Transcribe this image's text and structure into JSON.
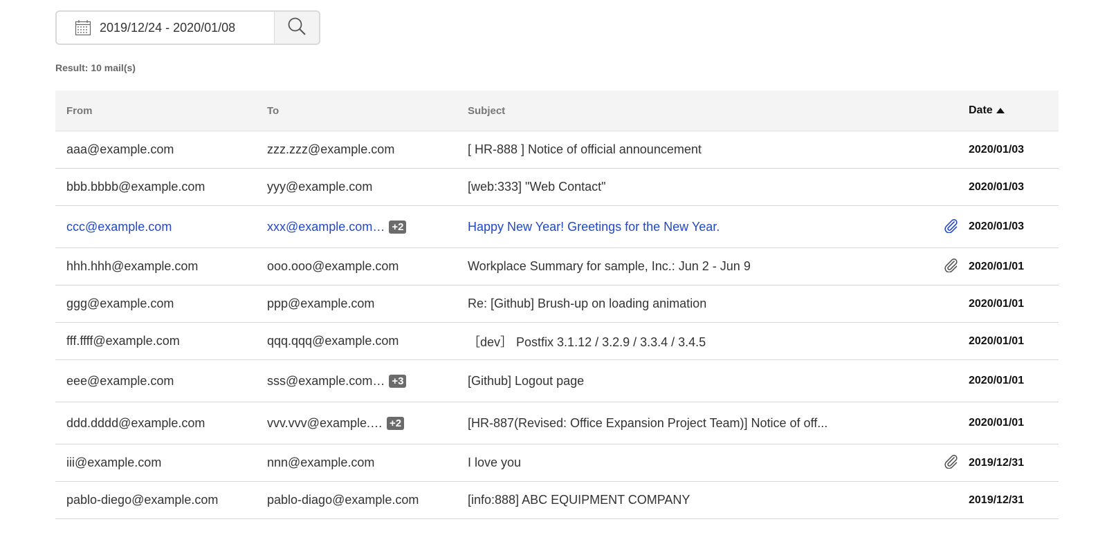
{
  "search": {
    "date_range": "2019/12/24 - 2020/01/08",
    "date_icon": "calendar-icon",
    "search_icon": "magnifier-icon"
  },
  "result_label": "Result: 10 mail(s)",
  "columns": {
    "from": "From",
    "to": "To",
    "subject": "Subject",
    "date": "Date"
  },
  "colors": {
    "unread": "#2148c9",
    "badge": "#6b6b6b",
    "header_bg": "#f4f4f4"
  },
  "rows": [
    {
      "from": "aaa@example.com",
      "to": "zzz.zzz@example.com",
      "badge": "",
      "subject": "[ HR-888 ] Notice of official announcement",
      "attachment": false,
      "date": "2020/01/03"
    },
    {
      "from": "bbb.bbbb@example.com",
      "to": "yyy@example.com",
      "badge": "",
      "subject": "[web:333] \"Web Contact\"",
      "attachment": false,
      "date": "2020/01/03"
    },
    {
      "from": "ccc@example.com",
      "to": "xxx@example.com…",
      "badge": "+2",
      "subject": "Happy New Year! Greetings for the New Year.",
      "attachment": true,
      "date": "2020/01/03",
      "unread": true
    },
    {
      "from": "hhh.hhh@example.com",
      "to": "ooo.ooo@example.com",
      "badge": "",
      "subject": "Workplace Summary for sample, Inc.: Jun 2 - Jun 9",
      "attachment": true,
      "date": "2020/01/01"
    },
    {
      "from": "ggg@example.com",
      "to": "ppp@example.com",
      "badge": "",
      "subject": "Re: [Github] Brush-up on loading animation",
      "attachment": false,
      "date": "2020/01/01"
    },
    {
      "from": "fff.ffff@example.com",
      "to": "qqq.qqq@example.com",
      "badge": "",
      "subject": "［dev］ Postfix 3.1.12 / 3.2.9 / 3.3.4 / 3.4.5",
      "attachment": false,
      "date": "2020/01/01"
    },
    {
      "from": "eee@example.com",
      "to": "sss@example.com…",
      "badge": "+3",
      "subject": "[Github] Logout page",
      "attachment": false,
      "date": "2020/01/01"
    },
    {
      "from": "ddd.dddd@example.com",
      "to": "vvv.vvv@example.…",
      "badge": "+2",
      "subject": "[HR-887(Revised: Office Expansion Project Team)] Notice of off...",
      "attachment": false,
      "date": "2020/01/01"
    },
    {
      "from": "iii@example.com",
      "to": "nnn@example.com",
      "badge": "",
      "subject": "I love you",
      "attachment": true,
      "date": "2019/12/31"
    },
    {
      "from": "pablo-diego@example.com",
      "to": "pablo-diago@example.com",
      "badge": "",
      "subject": "[info:888] ABC EQUIPMENT COMPANY",
      "attachment": false,
      "date": "2019/12/31"
    }
  ]
}
